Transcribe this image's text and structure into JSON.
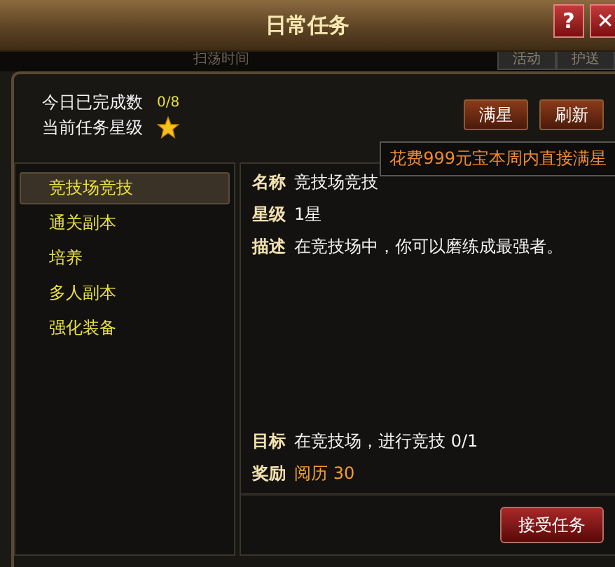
{
  "window": {
    "title": "日常任务",
    "help": "?",
    "close": "✕"
  },
  "background": {
    "label": "扫荡时间",
    "tabs": [
      "活动",
      "护送"
    ]
  },
  "summary": {
    "completed_label": "今日已完成数",
    "completed_value": "0/8",
    "star_label": "当前任务星级"
  },
  "actions": [
    {
      "label": "满星"
    },
    {
      "label": "刷新"
    }
  ],
  "tooltip": "花费999元宝本周内直接满星",
  "tasks": [
    {
      "label": "竞技场竞技",
      "selected": true
    },
    {
      "label": "通关副本",
      "selected": false
    },
    {
      "label": "培养",
      "selected": false
    },
    {
      "label": "多人副本",
      "selected": false
    },
    {
      "label": "强化装备",
      "selected": false
    }
  ],
  "details": [
    {
      "label": "名称",
      "value": "竞技场竞技"
    },
    {
      "label": "星级",
      "value": "1星"
    },
    {
      "label": "描述",
      "value": "在竞技场中，你可以磨练成最强者。"
    }
  ],
  "goal": {
    "label": "目标",
    "value": "在竞技场，进行竞技 0/1"
  },
  "reward": {
    "label": "奖励",
    "value": "阅历 30"
  },
  "accept_button": "接受任务"
}
